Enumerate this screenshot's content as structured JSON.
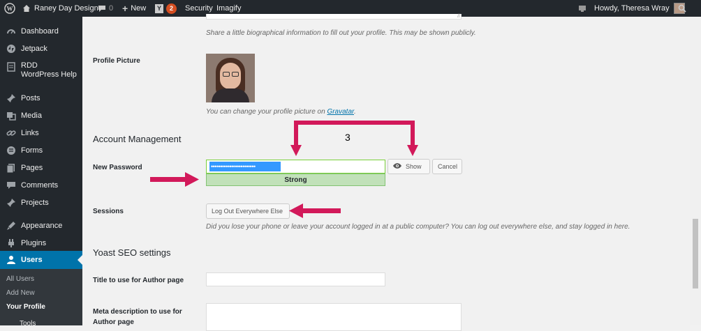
{
  "admin_bar": {
    "site_name": "Raney Day Design",
    "comments_count": "0",
    "new_label": "New",
    "yoast_badge": "2",
    "security_label": "Security",
    "imagify_label": "Imagify",
    "howdy": "Howdy, Theresa Wray"
  },
  "sidebar": {
    "items": [
      {
        "label": "Dashboard",
        "icon": "dashboard-icon"
      },
      {
        "label": "Jetpack",
        "icon": "jetpack-icon"
      },
      {
        "label": "RDD WordPress Help",
        "icon": "wordpress-icon"
      },
      {
        "label": "Posts",
        "icon": "pin-icon"
      },
      {
        "label": "Media",
        "icon": "media-icon"
      },
      {
        "label": "Links",
        "icon": "links-icon"
      },
      {
        "label": "Forms",
        "icon": "forms-icon"
      },
      {
        "label": "Pages",
        "icon": "pages-icon"
      },
      {
        "label": "Comments",
        "icon": "comments-icon"
      },
      {
        "label": "Projects",
        "icon": "pin-icon"
      },
      {
        "label": "Appearance",
        "icon": "appearance-icon"
      },
      {
        "label": "Plugins",
        "icon": "plugins-icon"
      },
      {
        "label": "Users",
        "icon": "users-icon"
      }
    ],
    "submenu": [
      "All Users",
      "Add New",
      "Your Profile"
    ],
    "cut_off_item": "Tools"
  },
  "profile": {
    "bio_description": "Share a little biographical information to fill out your profile. This may be shown publicly.",
    "picture_label": "Profile Picture",
    "picture_note_prefix": "You can change your profile picture on ",
    "gravatar_link": "Gravatar",
    "picture_note_suffix": "."
  },
  "account": {
    "title": "Account Management",
    "password_label": "New Password",
    "password_value": "••••••••••••••••••••••••",
    "strength": "Strong",
    "show_label": "Show",
    "cancel_label": "Cancel",
    "sessions_label": "Sessions",
    "logout_everywhere": "Log Out Everywhere Else",
    "sessions_desc": "Did you lose your phone or leave your account logged in at a public computer? You can log out everywhere else, and stay logged in here."
  },
  "annotation": {
    "step_number": "3"
  },
  "yoast": {
    "title": "Yoast SEO settings",
    "author_title_label": "Title to use for Author page",
    "meta_desc_label": "Meta description to use for Author page"
  },
  "colors": {
    "admin_dark": "#23282d",
    "active_blue": "#0073aa",
    "arrow_pink": "#d2195a",
    "strength_green": "#c1e1b9"
  }
}
